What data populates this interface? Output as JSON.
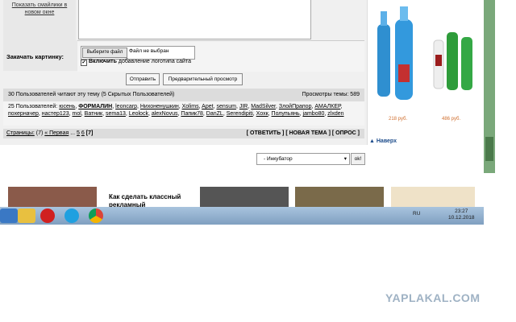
{
  "left_panel": {
    "smiles_link": "Показать смайлики в новом окне"
  },
  "attach": {
    "label": "Закачать картинку:",
    "file_button": "Выберите файл",
    "file_status": "Файл не выбран",
    "logo_checkbox_bold": "Включить",
    "logo_checkbox_rest": "добавление логотипа сайта"
  },
  "actions": {
    "send": "Отправить",
    "preview": "Предварительный просмотр"
  },
  "stats": {
    "readers": "30 Пользователей читают эту тему (5 Скрытых Пользователей)",
    "views": "Просмотры темы: 589"
  },
  "users": {
    "prefix": "25 Пользователей:",
    "list": [
      "юсень",
      "ФОРМАЛИН",
      "leoncarp",
      "Нихоненушкин",
      "Xolims",
      "Apet",
      "sensum",
      "JIR",
      "MadSilver",
      "ЗлойПрапор",
      "АМАЛКЕР",
      "похерначер",
      "настер123",
      "mol",
      "Ватник",
      "sema13",
      "Leolock",
      "alexNovus",
      "Папик78",
      "DanZL",
      "Serendipiti",
      "Хохк",
      "Полупьянь",
      "jambo80",
      "zlxden"
    ]
  },
  "pager": {
    "label": "Страницы:",
    "count": "(7)",
    "first": "« Первая",
    "dots": "...",
    "p5": "5",
    "p6": "6",
    "p7": "[7]",
    "actions": "[ ОТВЕТИТЬ ] [ НОВАЯ ТЕМА ] [ ОПРОС ]"
  },
  "ad": {
    "price1": "218 руб.",
    "price2": "486 руб."
  },
  "nav": {
    "up_link": "Наверх"
  },
  "forum_select": {
    "value": "- Инкубатор",
    "ok": "ok!"
  },
  "teaser": {
    "text": "Как сделать классный рекламный"
  },
  "taskbar": {
    "lang": "RU",
    "time": "23:27",
    "date": "10.12.2018"
  },
  "watermark": "YAPLAKAL.COM"
}
